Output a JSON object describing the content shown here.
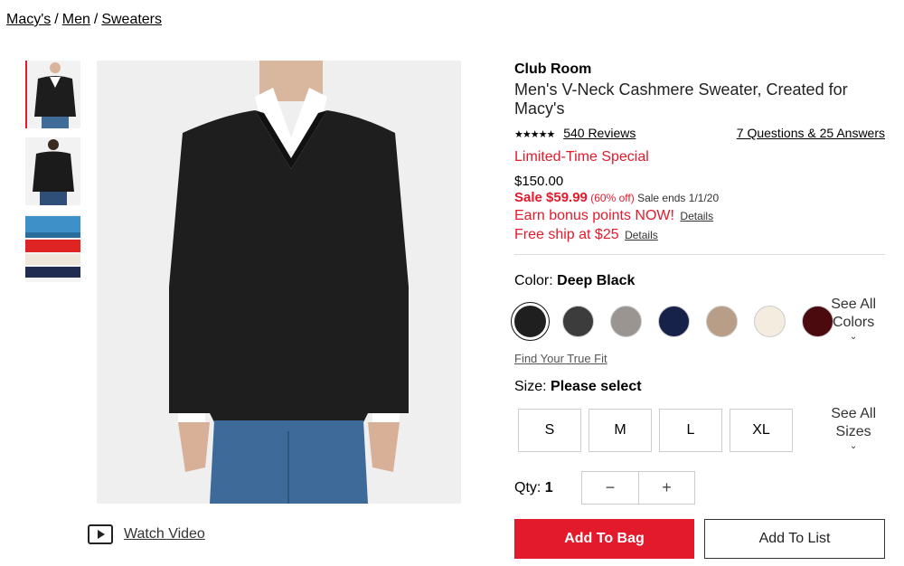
{
  "breadcrumb": [
    "Macy's",
    "Men",
    "Sweaters"
  ],
  "breadcrumb_sep": "/",
  "product": {
    "brand": "Club Room",
    "title": "Men's V-Neck Cashmere Sweater, Created for Macy's",
    "stars": "★★★★★",
    "reviews": "540 Reviews",
    "qa": "7 Questions & 25 Answers",
    "promo": "Limited-Time Special",
    "original_price": "$150.00",
    "sale_label": "Sale $59.99",
    "sale_pct": "(60% off)",
    "sale_ends": "Sale ends 1/1/20",
    "bonus": "Earn bonus points NOW!",
    "free_ship": "Free ship at $25",
    "details": "Details"
  },
  "color": {
    "label": "Color:",
    "selected": "Deep Black",
    "swatches": [
      "#1f1f1f",
      "#3c3c3c",
      "#9a9591",
      "#17224a",
      "#b89e86",
      "#f3ecdf",
      "#4a0a0e"
    ],
    "see_all_1": "See All",
    "see_all_2": "Colors"
  },
  "fit_link": "Find Your True Fit",
  "size": {
    "label": "Size:",
    "selected": "Please select",
    "options": [
      "S",
      "M",
      "L",
      "XL"
    ],
    "see_all_1": "See All",
    "see_all_2": "Sizes"
  },
  "qty": {
    "label": "Qty:",
    "value": "1",
    "minus": "−",
    "plus": "+"
  },
  "actions": {
    "add_bag": "Add To Bag",
    "add_list": "Add To List"
  },
  "video_label": "Watch Video",
  "colors": {
    "accent": "#e21a2c"
  }
}
